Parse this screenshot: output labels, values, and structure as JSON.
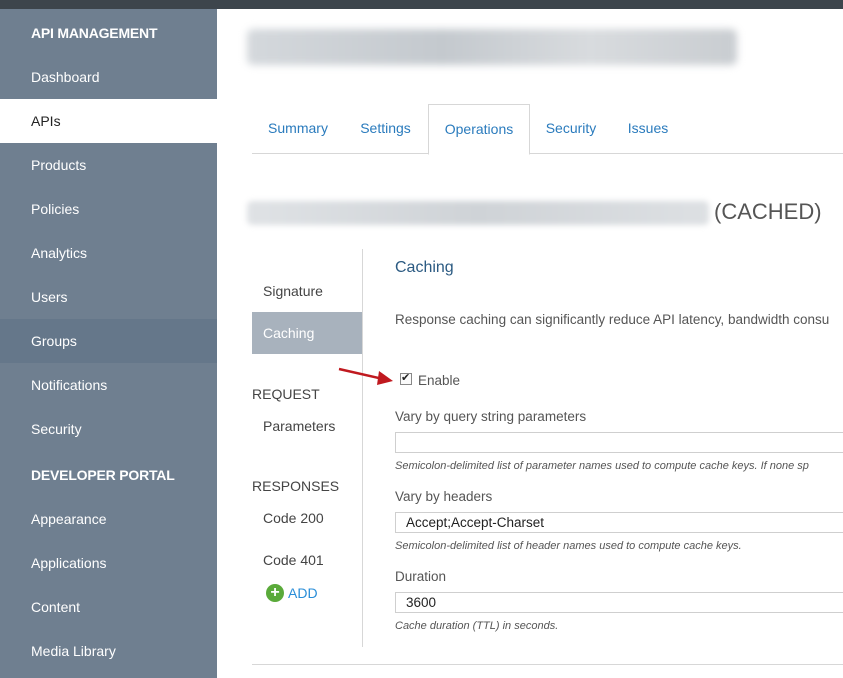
{
  "sidebar": {
    "api_heading": "API MANAGEMENT",
    "items": [
      {
        "label": "Dashboard"
      },
      {
        "label": "APIs"
      },
      {
        "label": "Products"
      },
      {
        "label": "Policies"
      },
      {
        "label": "Analytics"
      },
      {
        "label": "Users"
      },
      {
        "label": "Groups"
      },
      {
        "label": "Notifications"
      },
      {
        "label": "Security"
      }
    ],
    "portal_heading": "DEVELOPER PORTAL",
    "portal_items": [
      {
        "label": "Appearance"
      },
      {
        "label": "Applications"
      },
      {
        "label": "Content"
      },
      {
        "label": "Media Library"
      }
    ]
  },
  "tabs": [
    {
      "label": "Summary"
    },
    {
      "label": "Settings"
    },
    {
      "label": "Operations"
    },
    {
      "label": "Security"
    },
    {
      "label": "Issues"
    }
  ],
  "operation": {
    "suffix": "(CACHED)"
  },
  "subnav": {
    "signature": "Signature",
    "caching": "Caching",
    "request_heading": "REQUEST",
    "parameters": "Parameters",
    "responses_heading": "RESPONSES",
    "code_200": "Code 200",
    "code_401": "Code 401",
    "add_label": "ADD"
  },
  "caching": {
    "title": "Caching",
    "description": "Response caching can significantly reduce API latency, bandwidth consu",
    "enable_label": "Enable",
    "enable_checked": true,
    "query_label": "Vary by query string parameters",
    "query_value": "",
    "query_hint": "Semicolon-delimited list of parameter names used to compute cache keys. If none sp",
    "headers_label": "Vary by headers",
    "headers_value": "Accept;Accept-Charset",
    "headers_hint": "Semicolon-delimited list of header names used to compute cache keys.",
    "duration_label": "Duration",
    "duration_value": "3600",
    "duration_hint": "Cache duration (TTL) in seconds."
  },
  "colors": {
    "sidebar_bg": "#6f7f90",
    "link": "#2a7bbd",
    "arrow": "#c0191f",
    "add_icon": "#5aaa3a"
  }
}
